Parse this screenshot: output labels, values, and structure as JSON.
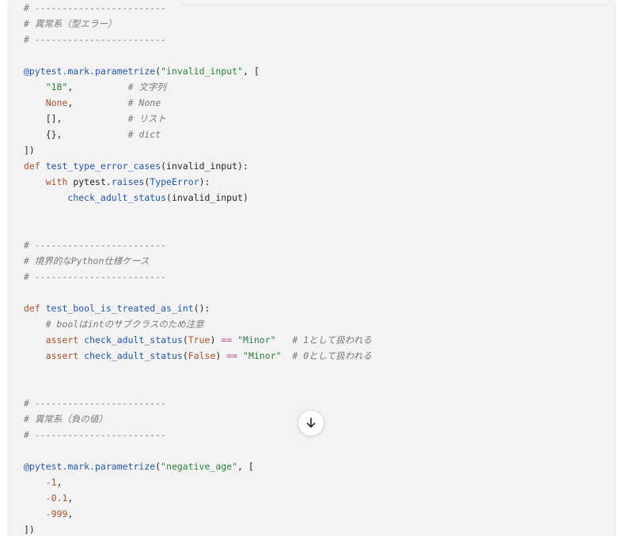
{
  "code_lines": [
    [
      {
        "t": "c",
        "v": "# ------------------------"
      }
    ],
    [
      {
        "t": "c",
        "v": "# 異常系（型エラー）"
      }
    ],
    [
      {
        "t": "c",
        "v": "# ------------------------"
      }
    ],
    [],
    [
      {
        "t": "dec",
        "v": "@pytest.mark.parametrize"
      },
      {
        "t": "p",
        "v": "("
      },
      {
        "t": "str",
        "v": "\"invalid_input\""
      },
      {
        "t": "p",
        "v": ", ["
      }
    ],
    [
      {
        "t": "p",
        "v": "    "
      },
      {
        "t": "str",
        "v": "\"18\""
      },
      {
        "t": "p",
        "v": ",          "
      },
      {
        "t": "c",
        "v": "# 文字列"
      }
    ],
    [
      {
        "t": "p",
        "v": "    "
      },
      {
        "t": "kw",
        "v": "None"
      },
      {
        "t": "p",
        "v": ",          "
      },
      {
        "t": "c",
        "v": "# None"
      }
    ],
    [
      {
        "t": "p",
        "v": "    [],            "
      },
      {
        "t": "c",
        "v": "# リスト"
      }
    ],
    [
      {
        "t": "p",
        "v": "    {},            "
      },
      {
        "t": "c",
        "v": "# dict"
      }
    ],
    [
      {
        "t": "p",
        "v": "])"
      }
    ],
    [
      {
        "t": "kw",
        "v": "def"
      },
      {
        "t": "p",
        "v": " "
      },
      {
        "t": "fn",
        "v": "test_type_error_cases"
      },
      {
        "t": "p",
        "v": "(invalid_input):"
      }
    ],
    [
      {
        "t": "p",
        "v": "    "
      },
      {
        "t": "kw",
        "v": "with"
      },
      {
        "t": "p",
        "v": " pytest."
      },
      {
        "t": "fn",
        "v": "raises"
      },
      {
        "t": "p",
        "v": "("
      },
      {
        "t": "cls",
        "v": "TypeError"
      },
      {
        "t": "p",
        "v": "):"
      }
    ],
    [
      {
        "t": "p",
        "v": "        "
      },
      {
        "t": "fn",
        "v": "check_adult_status"
      },
      {
        "t": "p",
        "v": "(invalid_input)"
      }
    ],
    [],
    [],
    [
      {
        "t": "c",
        "v": "# ------------------------"
      }
    ],
    [
      {
        "t": "c",
        "v": "# 境界的なPython仕様ケース"
      }
    ],
    [
      {
        "t": "c",
        "v": "# ------------------------"
      }
    ],
    [],
    [
      {
        "t": "kw",
        "v": "def"
      },
      {
        "t": "p",
        "v": " "
      },
      {
        "t": "fn",
        "v": "test_bool_is_treated_as_int"
      },
      {
        "t": "p",
        "v": "():"
      }
    ],
    [
      {
        "t": "p",
        "v": "    "
      },
      {
        "t": "c",
        "v": "# boolはintのサブクラスのため注意"
      }
    ],
    [
      {
        "t": "p",
        "v": "    "
      },
      {
        "t": "kw",
        "v": "assert"
      },
      {
        "t": "p",
        "v": " "
      },
      {
        "t": "fn",
        "v": "check_adult_status"
      },
      {
        "t": "p",
        "v": "("
      },
      {
        "t": "kw",
        "v": "True"
      },
      {
        "t": "p",
        "v": ") "
      },
      {
        "t": "op",
        "v": "=="
      },
      {
        "t": "p",
        "v": " "
      },
      {
        "t": "str",
        "v": "\"Minor\""
      },
      {
        "t": "p",
        "v": "   "
      },
      {
        "t": "c",
        "v": "# 1として扱われる"
      }
    ],
    [
      {
        "t": "p",
        "v": "    "
      },
      {
        "t": "kw",
        "v": "assert"
      },
      {
        "t": "p",
        "v": " "
      },
      {
        "t": "fn",
        "v": "check_adult_status"
      },
      {
        "t": "p",
        "v": "("
      },
      {
        "t": "kw",
        "v": "False"
      },
      {
        "t": "p",
        "v": ") "
      },
      {
        "t": "op",
        "v": "=="
      },
      {
        "t": "p",
        "v": " "
      },
      {
        "t": "str",
        "v": "\"Minor\""
      },
      {
        "t": "p",
        "v": "  "
      },
      {
        "t": "c",
        "v": "# 0として扱われる"
      }
    ],
    [],
    [],
    [
      {
        "t": "c",
        "v": "# ------------------------"
      }
    ],
    [
      {
        "t": "c",
        "v": "# 異常系（負の値）"
      }
    ],
    [
      {
        "t": "c",
        "v": "# ------------------------"
      }
    ],
    [],
    [
      {
        "t": "dec",
        "v": "@pytest.mark.parametrize"
      },
      {
        "t": "p",
        "v": "("
      },
      {
        "t": "str",
        "v": "\"negative_age\""
      },
      {
        "t": "p",
        "v": ", ["
      }
    ],
    [
      {
        "t": "p",
        "v": "    "
      },
      {
        "t": "num",
        "v": "-1"
      },
      {
        "t": "p",
        "v": ","
      }
    ],
    [
      {
        "t": "p",
        "v": "    "
      },
      {
        "t": "num",
        "v": "-0.1"
      },
      {
        "t": "p",
        "v": ","
      }
    ],
    [
      {
        "t": "p",
        "v": "    "
      },
      {
        "t": "num",
        "v": "-999"
      },
      {
        "t": "p",
        "v": ","
      }
    ],
    [
      {
        "t": "p",
        "v": "])"
      }
    ]
  ],
  "scroll_button": {
    "icon": "arrow-down-icon"
  }
}
